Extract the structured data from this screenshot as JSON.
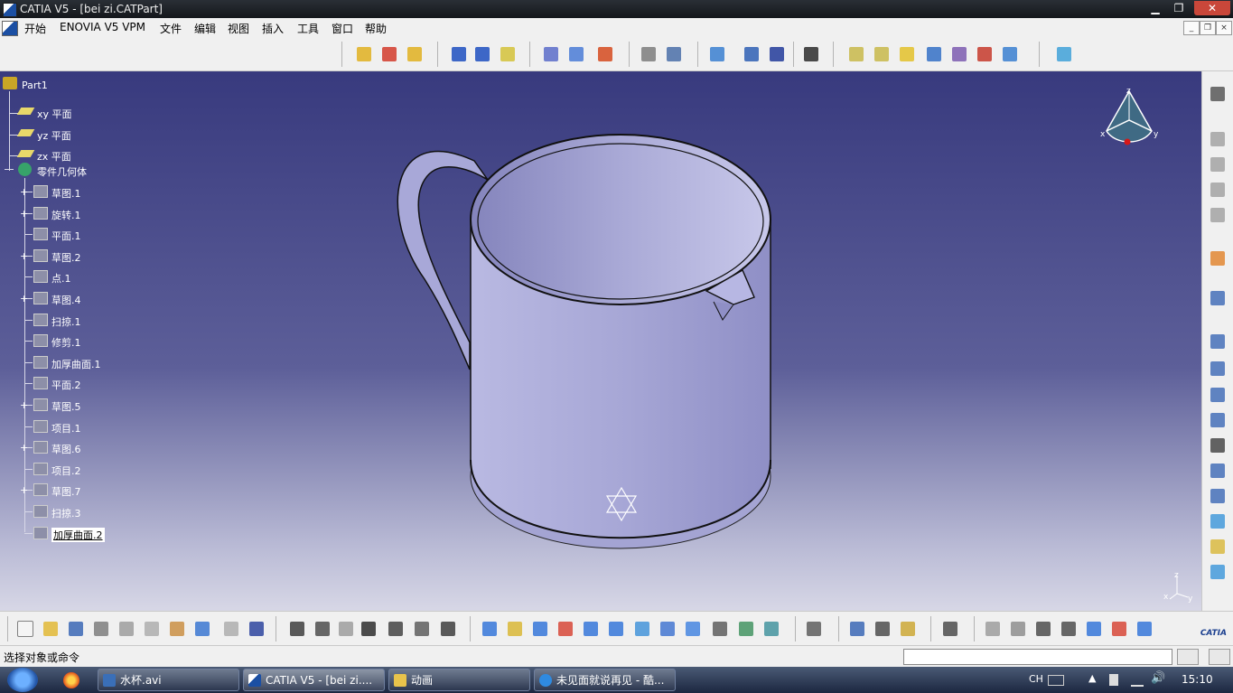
{
  "window": {
    "title": "CATIA V5 - [bei zi.CATPart]"
  },
  "menu": {
    "items": [
      "开始",
      "ENOVIA V5 VPM",
      "文件",
      "编辑",
      "视图",
      "插入",
      "工具",
      "窗口",
      "帮助"
    ]
  },
  "tree": {
    "root": "Part1",
    "planes": [
      "xy 平面",
      "yz 平面",
      "zx 平面"
    ],
    "body": "零件几何体",
    "features": [
      "草图.1",
      "旋转.1",
      "平面.1",
      "草图.2",
      "点.1",
      "草图.4",
      "扫掠.1",
      "修剪.1",
      "加厚曲面.1",
      "平面.2",
      "草图.5",
      "项目.1",
      "草图.6",
      "项目.2",
      "草图.7",
      "扫掠.3",
      "加厚曲面.2"
    ],
    "selected": "加厚曲面.2"
  },
  "compass_labels": {
    "x": "x",
    "y": "y",
    "z": "z"
  },
  "status": {
    "message": "选择对象或命令"
  },
  "taskbar": {
    "items": [
      "水杯.avi",
      "CATIA V5 - [bei zi....",
      "动画",
      "未见面就说再见 - 酷..."
    ],
    "lang": "CH",
    "time": "15:10"
  },
  "colors": {
    "viewport_top": "#383a7e",
    "viewport_bottom": "#d7d7e6",
    "part_surface": "#b3b3dd",
    "selection": "#ffffff"
  }
}
